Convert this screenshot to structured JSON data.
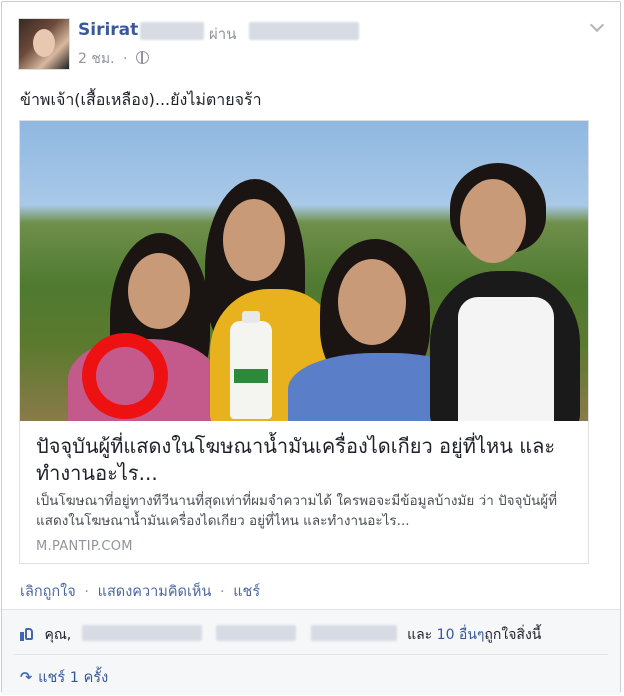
{
  "post": {
    "author": "Sirirat",
    "via_label": "ผ่าน",
    "time": "2 ชม.",
    "text": "ข้าพเจ้า(เสื้อเหลือง)...ยังไม่ตายจร้า"
  },
  "link": {
    "title": "ปัจจุบันผู้ที่แสดงในโฆษณาน้ำมันเครื่องไดเกียว อยู่ที่ไหน และทำงานอะไร...",
    "description": "เป็นโฆษณาที่อยู่ทางทีวีนานที่สุดเท่าที่ผมจำความได้ ใครพอจะมีข้อมูลบ้างมัย ว่า ปัจจุบันผู้ที่แสดงในโฆษณาน้ำมันเครื่องไดเกียว อยู่ที่ไหน และทำงานอะไร...",
    "domain": "M.PANTIP.COM"
  },
  "actions": {
    "unlike": "เลิกถูกใจ",
    "comment": "แสดงความคิดเห็น",
    "share": "แชร์",
    "separator": "·"
  },
  "likes": {
    "you": "คุณ,",
    "and": "และ",
    "others": "10 อื่นๆ",
    "suffix": "ถูกใจสิ่งนี้"
  },
  "shares": {
    "text": "แชร์ 1 ครั้ง"
  },
  "icons": [
    "globe-icon",
    "chevron-down-icon",
    "like-icon",
    "share-icon"
  ]
}
